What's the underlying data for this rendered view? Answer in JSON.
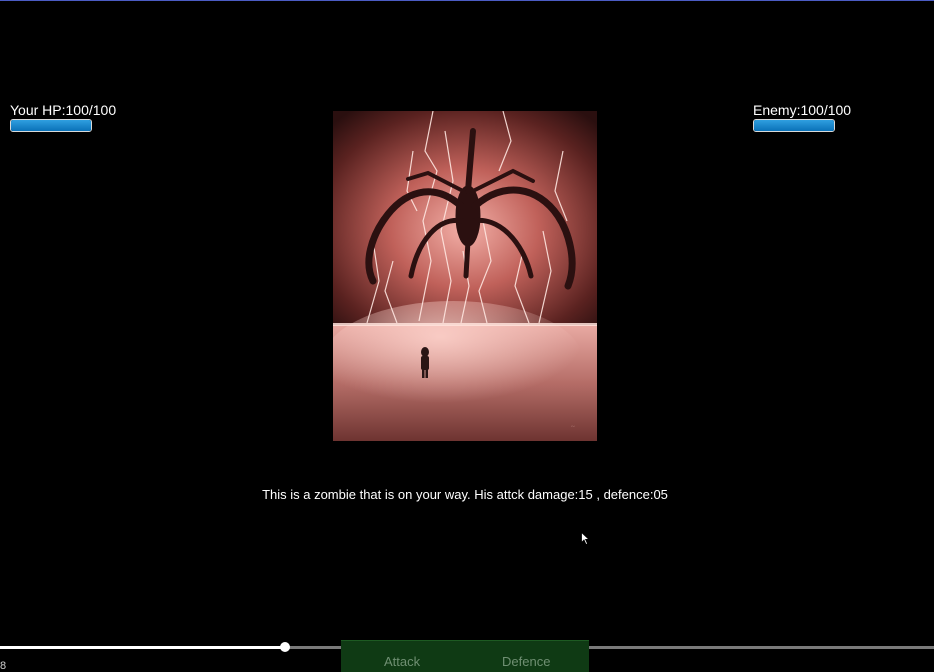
{
  "player": {
    "hp_label": "Your HP:100/100",
    "hp_percent": 100
  },
  "enemy": {
    "hp_label": "Enemy:100/100",
    "hp_percent": 100
  },
  "description": "This is a zombie that is on your way. His attck damage:15 , defence:05",
  "actions": {
    "attack_label": "Attack",
    "defence_label": "Defence"
  },
  "progress": {
    "percent": 30.5
  },
  "corner_text": "8",
  "colors": {
    "hp_fill": "#1d8ad0",
    "action_bar": "#0f3a14",
    "action_text": "#6f8f72"
  }
}
